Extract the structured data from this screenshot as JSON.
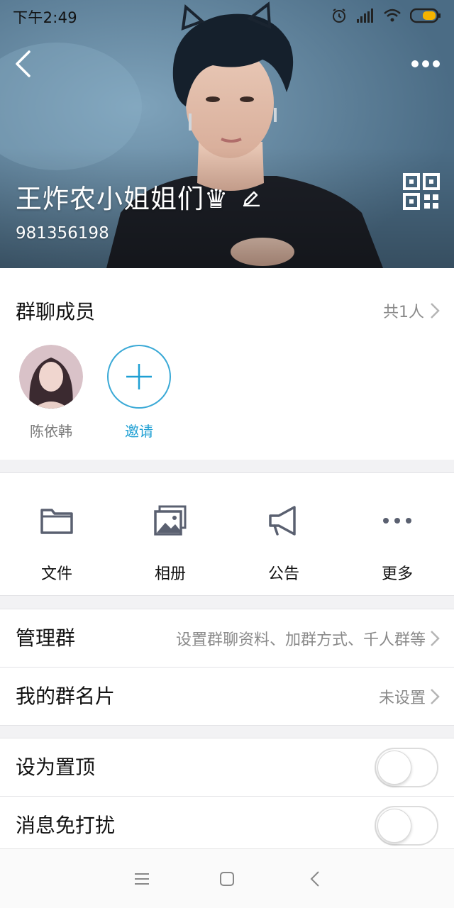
{
  "status_bar": {
    "time": "下午2:49",
    "icons": [
      "alarm-icon",
      "signal-icon",
      "wifi-icon",
      "battery-icon"
    ],
    "battery_color": "#f5b400"
  },
  "header": {
    "group_name": "王炸农小姐姐们♛",
    "group_id": "981356198",
    "icons": [
      "back-icon",
      "more-icon",
      "edit-icon",
      "qr-code-icon"
    ]
  },
  "members": {
    "title": "群聊成员",
    "count": "共1人",
    "list": [
      {
        "name": "陈依韩",
        "icon": "avatar"
      },
      {
        "name": "邀请",
        "icon": "plus-icon"
      }
    ]
  },
  "functions": [
    {
      "label": "文件",
      "icon": "folder-icon"
    },
    {
      "label": "相册",
      "icon": "album-icon"
    },
    {
      "label": "公告",
      "icon": "megaphone-icon"
    },
    {
      "label": "更多",
      "icon": "more-dots-icon"
    }
  ],
  "settings": {
    "manage": {
      "title": "管理群",
      "value": "设置群聊资料、加群方式、千人群等"
    },
    "card": {
      "title": "我的群名片",
      "value": "未设置"
    },
    "pin": {
      "title": "设为置顶",
      "on": false
    },
    "mute": {
      "title": "消息免打扰",
      "on": false
    }
  },
  "colors": {
    "accent": "#1e9fd3",
    "icon_gray": "#5a6070",
    "divider": "#e3e3e6"
  },
  "nav_bar": {
    "icons": [
      "menu-icon",
      "home-square-icon",
      "back-chevron-icon"
    ]
  }
}
